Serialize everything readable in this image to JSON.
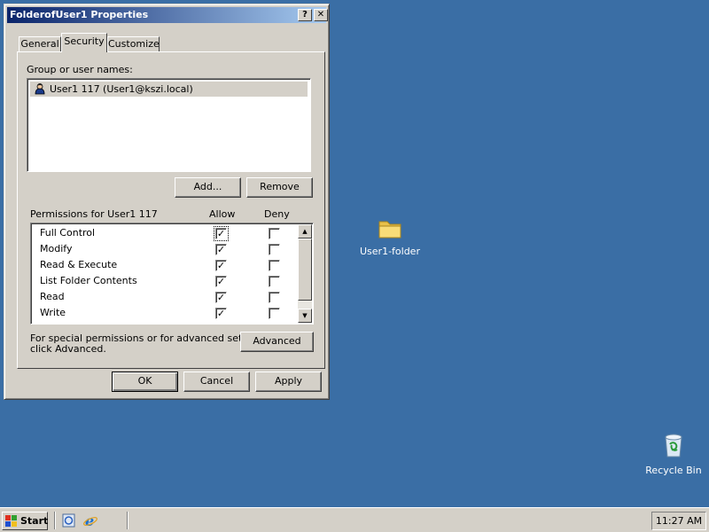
{
  "window": {
    "title": "FolderofUser1 Properties",
    "help_label": "?",
    "close_label": "✕",
    "tabs": [
      {
        "label": "General",
        "active": false
      },
      {
        "label": "Security",
        "active": true
      },
      {
        "label": "Customize",
        "active": false
      }
    ],
    "security": {
      "group_label": "Group or user names:",
      "users": [
        {
          "label": "User1 117 (User1@kszi.local)",
          "icon": "user-icon",
          "selected": true
        }
      ],
      "add_label": "Add...",
      "remove_label": "Remove",
      "permissions_label": "Permissions for User1 117",
      "allow_header": "Allow",
      "deny_header": "Deny",
      "permissions": [
        {
          "name": "Full Control",
          "allow": true,
          "deny": false
        },
        {
          "name": "Modify",
          "allow": true,
          "deny": false
        },
        {
          "name": "Read & Execute",
          "allow": true,
          "deny": false
        },
        {
          "name": "List Folder Contents",
          "allow": true,
          "deny": false
        },
        {
          "name": "Read",
          "allow": true,
          "deny": false
        },
        {
          "name": "Write",
          "allow": true,
          "deny": false
        }
      ],
      "special_text_line1": "For special permissions or for advanced settings,",
      "special_text_line2": "click Advanced.",
      "advanced_label": "Advanced"
    },
    "buttons": {
      "ok": "OK",
      "cancel": "Cancel",
      "apply": "Apply"
    }
  },
  "desktop": {
    "icons": [
      {
        "label": "User1-folder",
        "icon": "folder-icon"
      },
      {
        "label": "Recycle Bin",
        "icon": "recycle-bin-icon"
      }
    ],
    "background_color": "#3a6ea5"
  },
  "taskbar": {
    "start_label": "Start",
    "quick_launch": [
      "server-manager-icon",
      "internet-explorer-icon"
    ],
    "clock": "11:27 AM"
  }
}
